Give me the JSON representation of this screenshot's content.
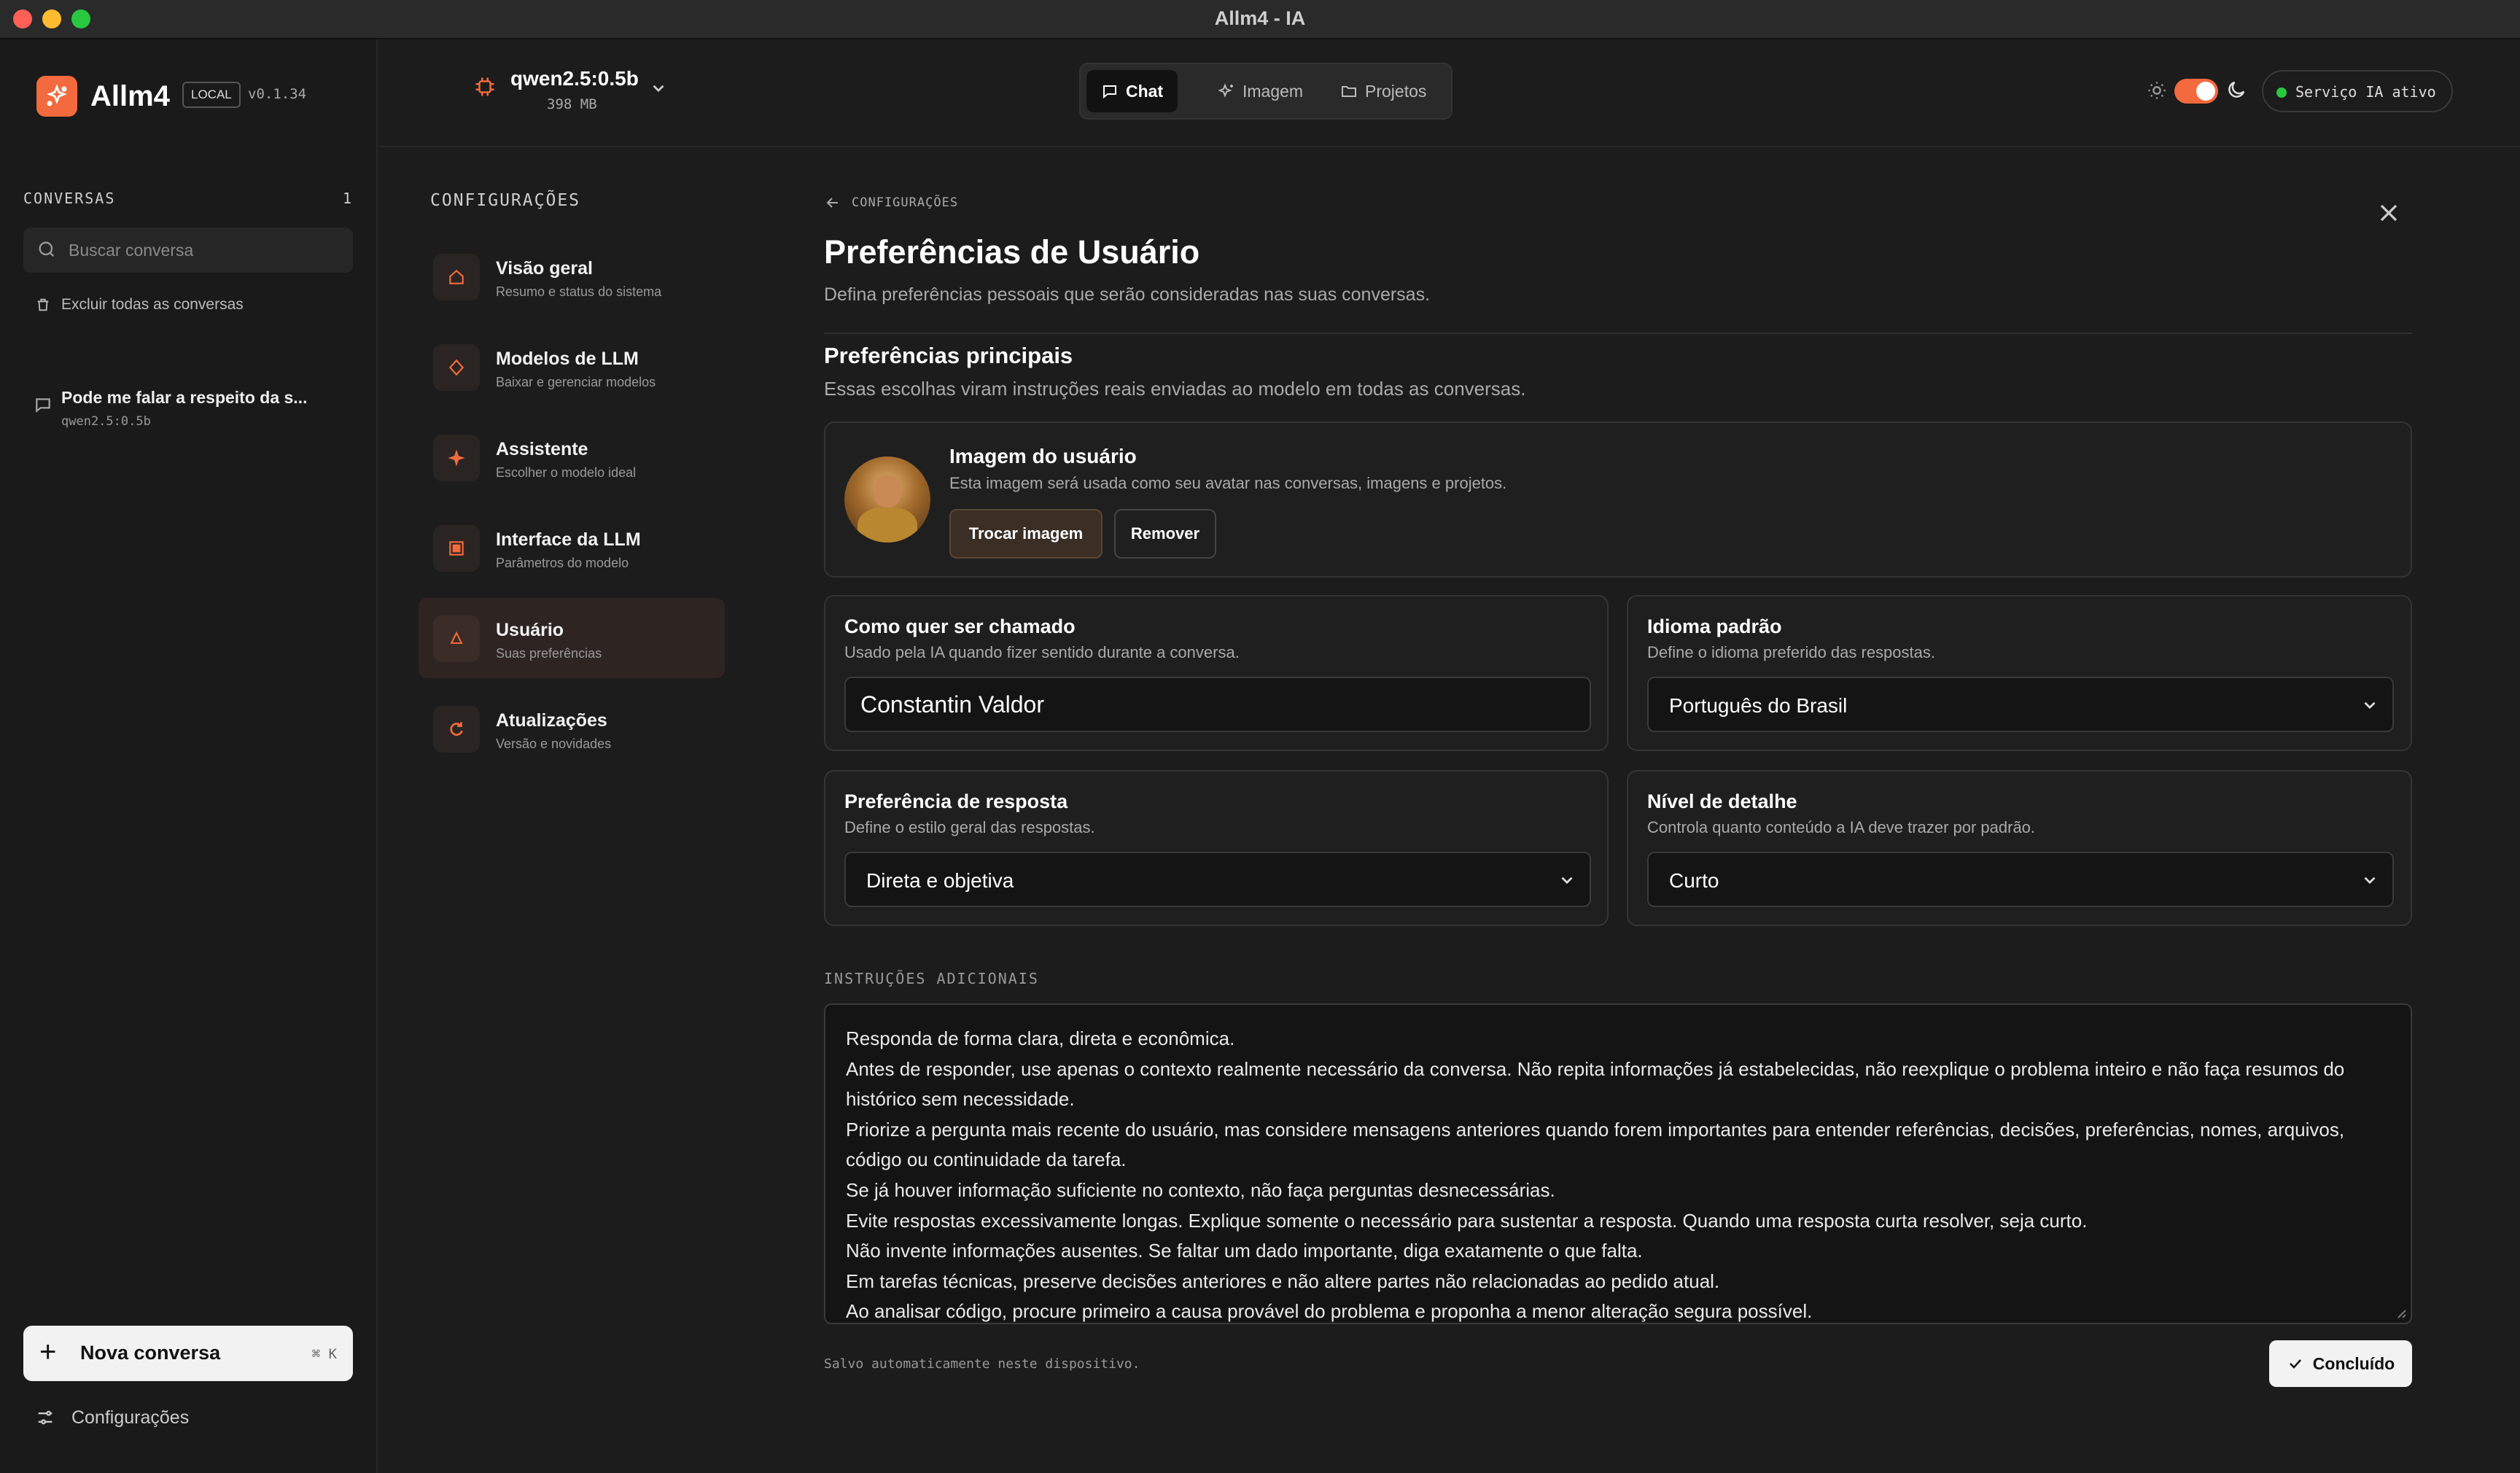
{
  "window": {
    "title": "Allm4 - IA"
  },
  "brand": {
    "name": "Allm4",
    "badge": "LOCAL",
    "version": "v0.1.34",
    "accent": "#f26a3d"
  },
  "sidebar": {
    "conversations_label": "CONVERSAS",
    "conversations_count": "1",
    "search_placeholder": "Buscar conversa",
    "delete_all_label": "Excluir todas as conversas",
    "conversations": [
      {
        "title": "Pode me falar a respeito da s...",
        "model": "qwen2.5:0.5b"
      }
    ],
    "new_conversation": {
      "label": "Nova conversa",
      "shortcut": "⌘ K"
    },
    "settings_label": "Configurações"
  },
  "topbar": {
    "model": {
      "name": "qwen2.5:0.5b",
      "size": "398 MB"
    },
    "tabs": [
      {
        "label": "Chat",
        "icon": "chat-bubble-icon",
        "active": true
      },
      {
        "label": "Imagem",
        "icon": "sparkles-icon",
        "active": false
      },
      {
        "label": "Projetos",
        "icon": "folder-icon",
        "active": false
      }
    ],
    "theme_toggle": {
      "mode": "dark"
    },
    "service_status": "Serviço IA ativo"
  },
  "settings_nav": {
    "heading": "CONFIGURAÇÕES",
    "items": [
      {
        "title": "Visão geral",
        "subtitle": "Resumo e status do sistema",
        "icon": "home-icon",
        "active": false
      },
      {
        "title": "Modelos de LLM",
        "subtitle": "Baixar e gerenciar modelos",
        "icon": "diamond-icon",
        "active": false
      },
      {
        "title": "Assistente",
        "subtitle": "Escolher o modelo ideal",
        "icon": "sparkle-icon",
        "active": false
      },
      {
        "title": "Interface da LLM",
        "subtitle": "Parâmetros do modelo",
        "icon": "square-icon",
        "active": false
      },
      {
        "title": "Usuário",
        "subtitle": "Suas preferências",
        "icon": "user-icon",
        "active": true
      },
      {
        "title": "Atualizações",
        "subtitle": "Versão e novidades",
        "icon": "refresh-icon",
        "active": false
      }
    ]
  },
  "main": {
    "back_label": "CONFIGURAÇÕES",
    "title": "Preferências de Usuário",
    "subtitle": "Defina preferências pessoais que serão consideradas nas suas conversas.",
    "section_title": "Preferências principais",
    "section_subtitle": "Essas escolhas viram instruções reais enviadas ao modelo em todas as conversas.",
    "avatar_card": {
      "title": "Imagem do usuário",
      "subtitle": "Esta imagem será usada como seu avatar nas conversas, imagens e projetos.",
      "change_label": "Trocar imagem",
      "remove_label": "Remover"
    },
    "name_field": {
      "title": "Como quer ser chamado",
      "subtitle": "Usado pela IA quando fizer sentido durante a conversa.",
      "value": "Constantin Valdor"
    },
    "language_field": {
      "title": "Idioma padrão",
      "subtitle": "Define o idioma preferido das respostas.",
      "value": "Português do Brasil"
    },
    "response_field": {
      "title": "Preferência de resposta",
      "subtitle": "Define o estilo geral das respostas.",
      "value": "Direta e objetiva"
    },
    "detail_field": {
      "title": "Nível de detalhe",
      "subtitle": "Controla quanto conteúdo a IA deve trazer por padrão.",
      "value": "Curto"
    },
    "extra_instructions": {
      "label": "INSTRUÇÕES ADICIONAIS",
      "lines": [
        "Responda de forma clara, direta e econômica.",
        "Antes de responder, use apenas o contexto realmente necessário da conversa. Não repita informações já estabelecidas, não reexplique o problema inteiro e não faça resumos do histórico sem necessidade.",
        "Priorize a pergunta mais recente do usuário, mas considere mensagens anteriores quando forem importantes para entender referências, decisões, preferências, nomes, arquivos, código ou continuidade da tarefa.",
        "Se já houver informação suficiente no contexto, não faça perguntas desnecessárias.",
        "Evite respostas excessivamente longas. Explique somente o necessário para sustentar a resposta. Quando uma resposta curta resolver, seja curto.",
        "Não invente informações ausentes. Se faltar um dado importante, diga exatamente o que falta.",
        "Em tarefas técnicas, preserve decisões anteriores e não altere partes não relacionadas ao pedido atual.",
        "Ao analisar código, procure primeiro a causa provável do problema e proponha a menor alteração segura possível."
      ]
    },
    "saved_note": "Salvo automaticamente neste dispositivo.",
    "done_label": "Concluído"
  }
}
